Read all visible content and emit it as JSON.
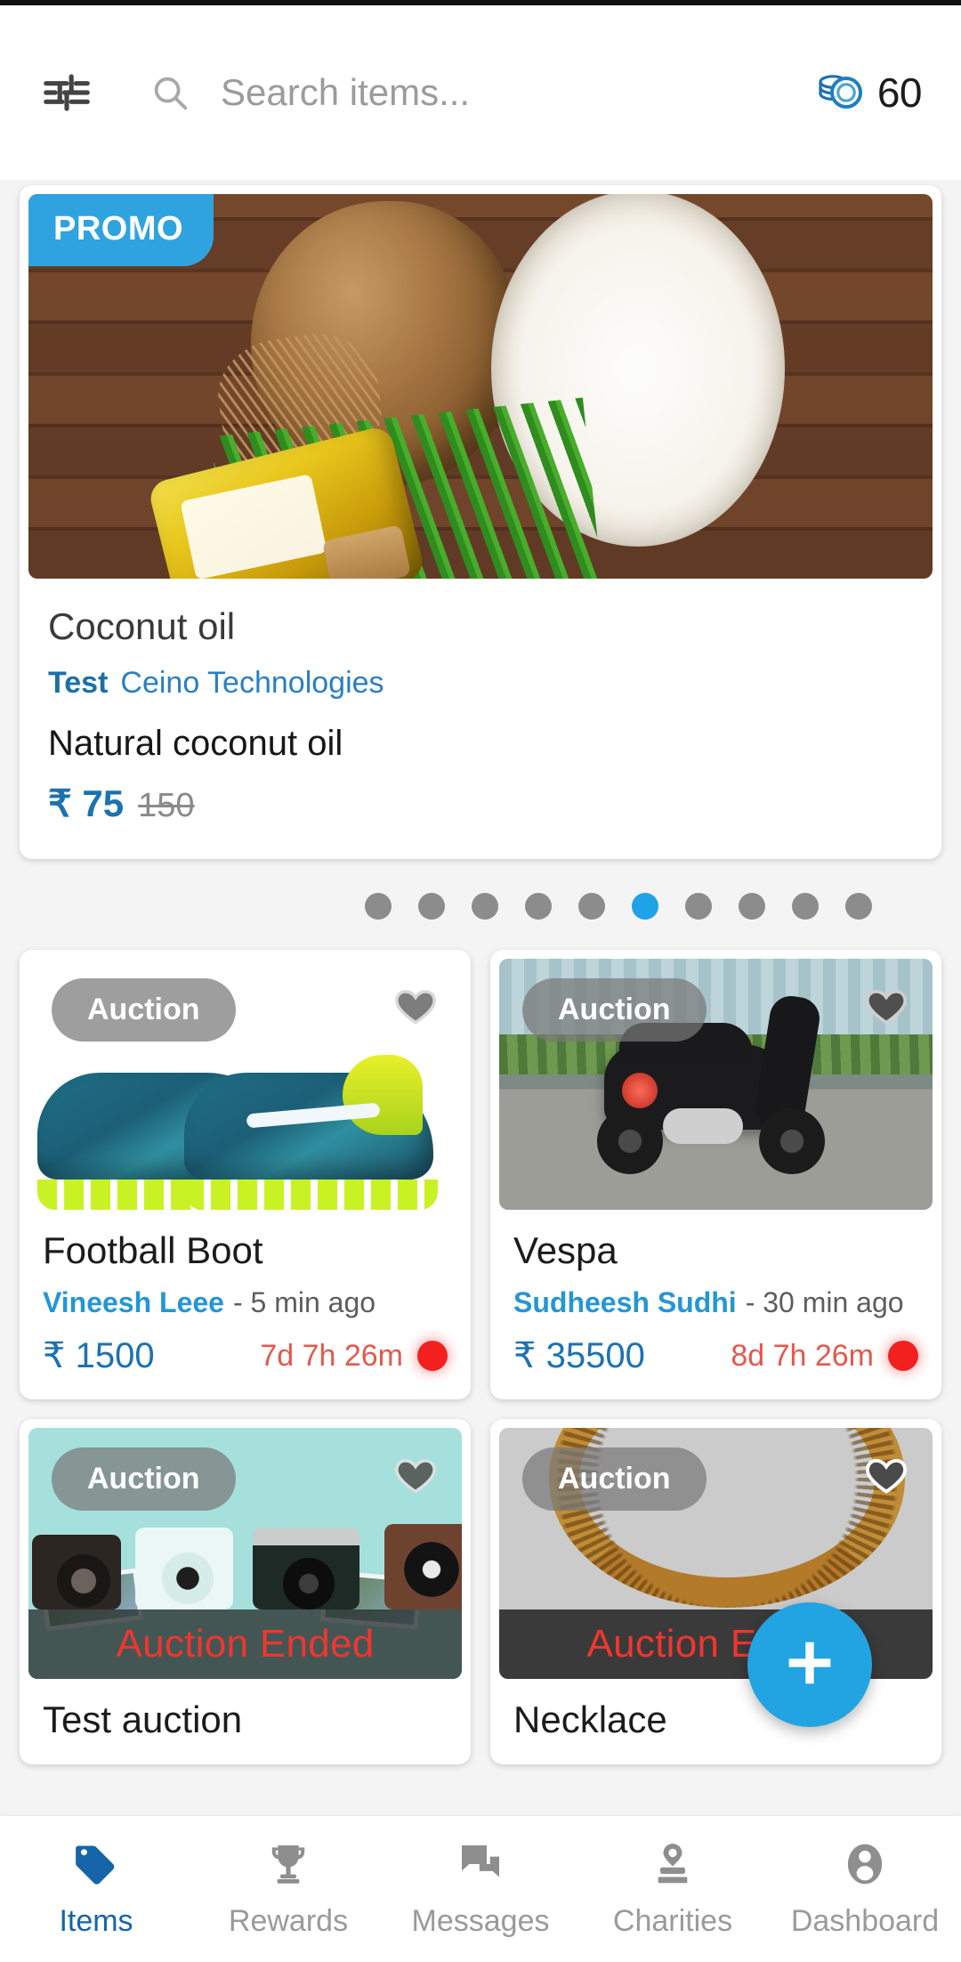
{
  "header": {
    "filter_icon": "tune-filter-icon",
    "search": {
      "icon": "search-icon",
      "placeholder": "Search items...",
      "value": ""
    },
    "coins": {
      "icon": "coin-stack-icon",
      "count": "60",
      "color": "#1c72b0"
    }
  },
  "promo": {
    "badge": "PROMO",
    "badge_color": "#2fa3e0",
    "title": "Coconut oil",
    "tag_label": "Test",
    "organization": "Ceino Technologies",
    "description": "Natural coconut oil",
    "currency": "₹",
    "price": "75",
    "old_price": "150",
    "image_alt": "coconut-oil-photo"
  },
  "carousel": {
    "total": 10,
    "active_index": 5
  },
  "items": [
    {
      "badge": "Auction",
      "favorite_icon": "heart-icon",
      "image_alt": "football-boot-photo",
      "title": "Football Boot",
      "seller": "Vineesh Leee",
      "posted": "- 5 min ago",
      "currency": "₹",
      "price": "1500",
      "timer": "7d 7h 26m",
      "live": true,
      "ended": false,
      "ended_label": ""
    },
    {
      "badge": "Auction",
      "favorite_icon": "heart-icon",
      "image_alt": "vespa-scooter-photo",
      "title": "Vespa",
      "seller": "Sudheesh Sudhi",
      "posted": "- 30 min ago",
      "currency": "₹",
      "price": "35500",
      "timer": "8d 7h 26m",
      "live": true,
      "ended": false,
      "ended_label": ""
    },
    {
      "badge": "Auction",
      "favorite_icon": "heart-icon",
      "image_alt": "vintage-cameras-photo",
      "title": "Test auction",
      "seller": "",
      "posted": "",
      "currency": "",
      "price": "",
      "timer": "",
      "live": false,
      "ended": true,
      "ended_label": "Auction Ended"
    },
    {
      "badge": "Auction",
      "favorite_icon": "heart-icon",
      "image_alt": "gold-necklace-photo",
      "title": "Necklace",
      "seller": "",
      "posted": "",
      "currency": "",
      "price": "",
      "timer": "",
      "live": false,
      "ended": true,
      "ended_label": "Auction Ended"
    }
  ],
  "fab": {
    "icon": "plus-icon",
    "label": "+",
    "color": "#22a3e2"
  },
  "bottom_nav": {
    "active_color": "#1565a8",
    "inactive_color": "#9a9a9a",
    "items": [
      {
        "label": "Items",
        "icon": "price-tag-icon",
        "active": true
      },
      {
        "label": "Rewards",
        "icon": "trophy-icon",
        "active": false
      },
      {
        "label": "Messages",
        "icon": "chat-bubble-icon",
        "active": false
      },
      {
        "label": "Charities",
        "icon": "charity-donation-icon",
        "active": false
      },
      {
        "label": "Dashboard",
        "icon": "account-circle-icon",
        "active": false
      }
    ]
  }
}
